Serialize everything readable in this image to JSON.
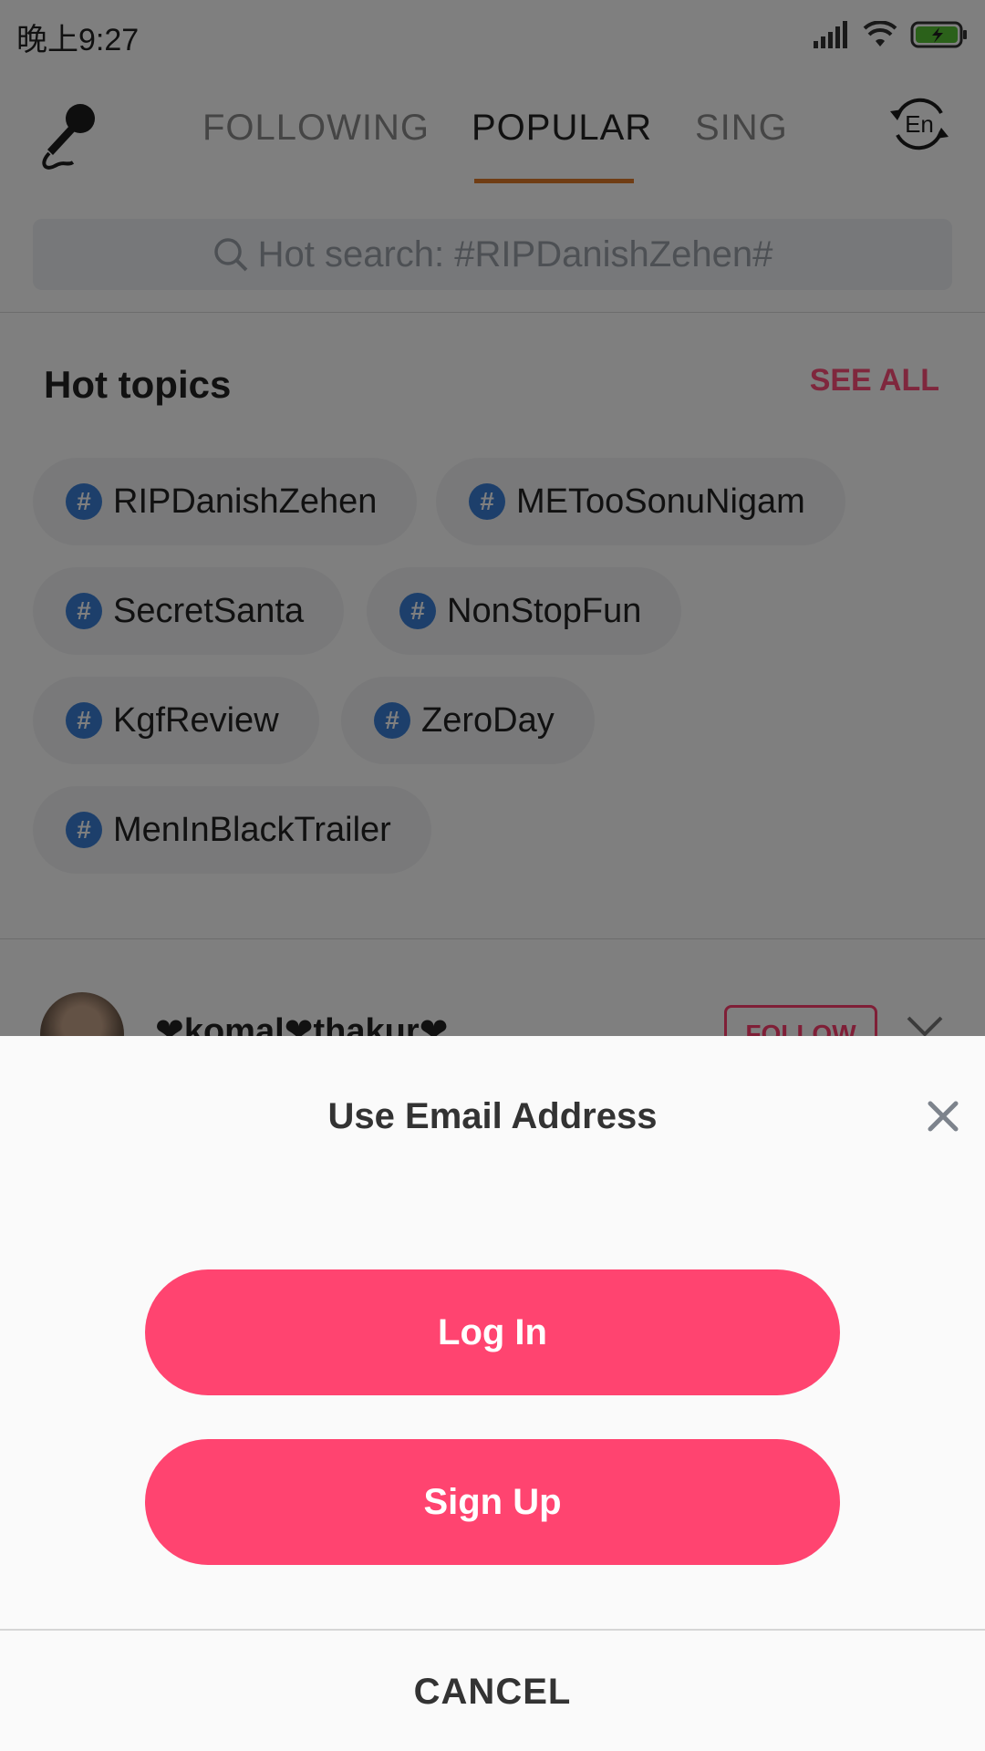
{
  "status_bar": {
    "time": "晚上9:27"
  },
  "nav": {
    "tabs": [
      {
        "label": "FOLLOWING"
      },
      {
        "label": "POPULAR"
      },
      {
        "label": "SING"
      }
    ],
    "active_tab": "POPULAR",
    "lang_label": "En"
  },
  "search": {
    "placeholder": "Hot search: #RIPDanishZehen#"
  },
  "hot_topics": {
    "title": "Hot topics",
    "see_all": "SEE ALL",
    "topics": [
      "RIPDanishZehen",
      "METooSonuNigam",
      "SecretSanta",
      "NonStopFun",
      "KgfReview",
      "ZeroDay",
      "MenInBlackTrailer"
    ],
    "hash_symbol": "#"
  },
  "feed": {
    "username": "❤komal❤thakur❤",
    "follow_label": "FOLLOW"
  },
  "sheet": {
    "title": "Use Email Address",
    "login_label": "Log In",
    "signup_label": "Sign Up",
    "cancel_label": "CANCEL"
  },
  "colors": {
    "accent": "#ff4470",
    "tab_underline": "#e07a28",
    "hash_badge": "#3a7fd6",
    "battery": "#56c234"
  }
}
